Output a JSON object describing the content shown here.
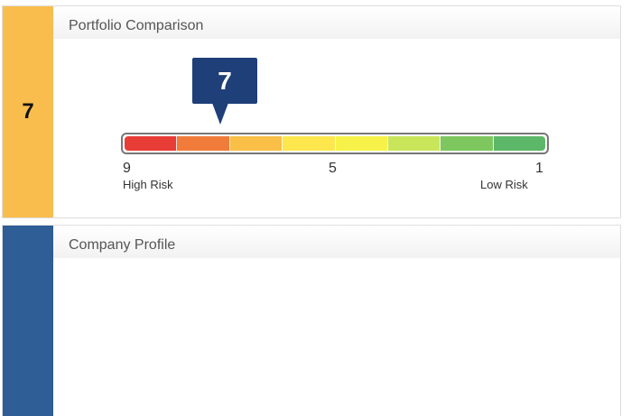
{
  "portfolio": {
    "score": "7",
    "title": "Portfolio Comparison",
    "callout_value": "7",
    "gauge": {
      "segments": [
        "#e83c36",
        "#f07b3a",
        "#f9bf47",
        "#fde74c",
        "#f6f24a",
        "#c9e55a",
        "#7ec75f",
        "#5cb868"
      ],
      "min_label": "9",
      "mid_label": "5",
      "max_label": "1",
      "high_label": "High Risk",
      "low_label": "Low Risk",
      "indicated_value": 7
    },
    "side_color": "#f9bd4d",
    "callout_color": "#1e3f78"
  },
  "company": {
    "title": "Company Profile",
    "side_color": "#2f5d96"
  }
}
